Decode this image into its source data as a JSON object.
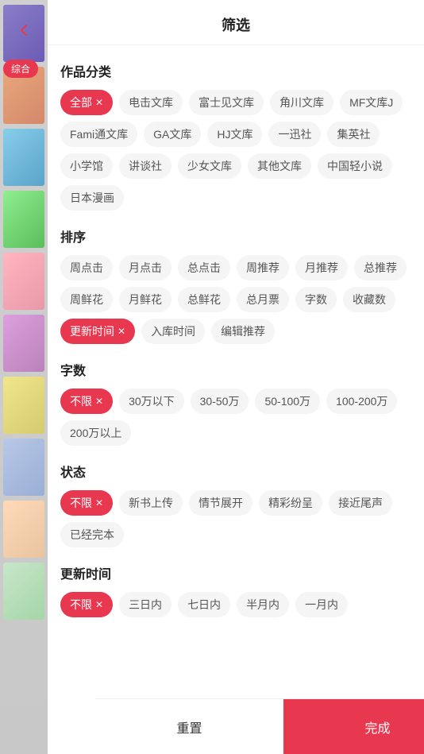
{
  "header": {
    "title": "筛选",
    "back_icon": "‹"
  },
  "left_sidebar": {
    "tab_label": "综",
    "tab_suffix": "合"
  },
  "sections": {
    "category": {
      "title": "作品分类",
      "tags": [
        {
          "id": "all",
          "label": "全部",
          "active": true
        },
        {
          "id": "dianji",
          "label": "电击文库",
          "active": false
        },
        {
          "id": "fujimi",
          "label": "富士见文库",
          "active": false
        },
        {
          "id": "kadokawa",
          "label": "角川文库",
          "active": false
        },
        {
          "id": "mfj",
          "label": "MF文库J",
          "active": false
        },
        {
          "id": "fami",
          "label": "Fami通文库",
          "active": false
        },
        {
          "id": "ga",
          "label": "GA文库",
          "active": false
        },
        {
          "id": "hj",
          "label": "HJ文库",
          "active": false
        },
        {
          "id": "yizhun",
          "label": "一迅社",
          "active": false
        },
        {
          "id": "jishe",
          "label": "集英社",
          "active": false
        },
        {
          "id": "xiaoxue",
          "label": "小学馆",
          "active": false
        },
        {
          "id": "jiangtan",
          "label": "讲谈社",
          "active": false
        },
        {
          "id": "shaonv",
          "label": "少女文库",
          "active": false
        },
        {
          "id": "qita",
          "label": "其他文库",
          "active": false
        },
        {
          "id": "zhongguo",
          "label": "中国轻小说",
          "active": false
        },
        {
          "id": "manhua",
          "label": "日本漫画",
          "active": false
        }
      ]
    },
    "sort": {
      "title": "排序",
      "tags": [
        {
          "id": "weekly_click",
          "label": "周点击",
          "active": false
        },
        {
          "id": "monthly_click",
          "label": "月点击",
          "active": false
        },
        {
          "id": "total_click",
          "label": "总点击",
          "active": false
        },
        {
          "id": "weekly_rec",
          "label": "周推荐",
          "active": false
        },
        {
          "id": "monthly_rec",
          "label": "月推荐",
          "active": false
        },
        {
          "id": "total_rec",
          "label": "总推荐",
          "active": false
        },
        {
          "id": "weekly_fresh",
          "label": "周鲜花",
          "active": false
        },
        {
          "id": "monthly_fresh",
          "label": "月鲜花",
          "active": false
        },
        {
          "id": "total_fresh",
          "label": "总鲜花",
          "active": false
        },
        {
          "id": "total_monthly_ticket",
          "label": "总月票",
          "active": false
        },
        {
          "id": "word_count",
          "label": "字数",
          "active": false
        },
        {
          "id": "collections",
          "label": "收藏数",
          "active": false
        },
        {
          "id": "update_time",
          "label": "更新时间",
          "active": true
        },
        {
          "id": "entry_time",
          "label": "入库时间",
          "active": false
        },
        {
          "id": "editor_rec",
          "label": "编辑推荐",
          "active": false
        }
      ]
    },
    "word_count": {
      "title": "字数",
      "tags": [
        {
          "id": "unlimited",
          "label": "不限",
          "active": true
        },
        {
          "id": "under30",
          "label": "30万以下",
          "active": false
        },
        {
          "id": "30to50",
          "label": "30-50万",
          "active": false
        },
        {
          "id": "50to100",
          "label": "50-100万",
          "active": false
        },
        {
          "id": "100to200",
          "label": "100-200万",
          "active": false
        },
        {
          "id": "over200",
          "label": "200万以上",
          "active": false
        }
      ]
    },
    "status": {
      "title": "状态",
      "tags": [
        {
          "id": "unlimited",
          "label": "不限",
          "active": true
        },
        {
          "id": "new_upload",
          "label": "新书上传",
          "active": false
        },
        {
          "id": "plot_expand",
          "label": "情节展开",
          "active": false
        },
        {
          "id": "wonderful",
          "label": "精彩纷呈",
          "active": false
        },
        {
          "id": "near_end",
          "label": "接近尾声",
          "active": false
        },
        {
          "id": "completed",
          "label": "已经完本",
          "active": false
        }
      ]
    },
    "update_time": {
      "title": "更新时间",
      "tags": [
        {
          "id": "unlimited",
          "label": "不限",
          "active": true
        },
        {
          "id": "3days",
          "label": "三日内",
          "active": false
        },
        {
          "id": "7days",
          "label": "七日内",
          "active": false
        },
        {
          "id": "halfmonth",
          "label": "半月内",
          "active": false
        },
        {
          "id": "1month",
          "label": "一月内",
          "active": false
        }
      ]
    }
  },
  "footer": {
    "reset_label": "重置",
    "confirm_label": "完成"
  },
  "colors": {
    "active_bg": "#e8384f",
    "active_text": "#ffffff",
    "inactive_bg": "#f5f5f5",
    "inactive_text": "#555555"
  }
}
